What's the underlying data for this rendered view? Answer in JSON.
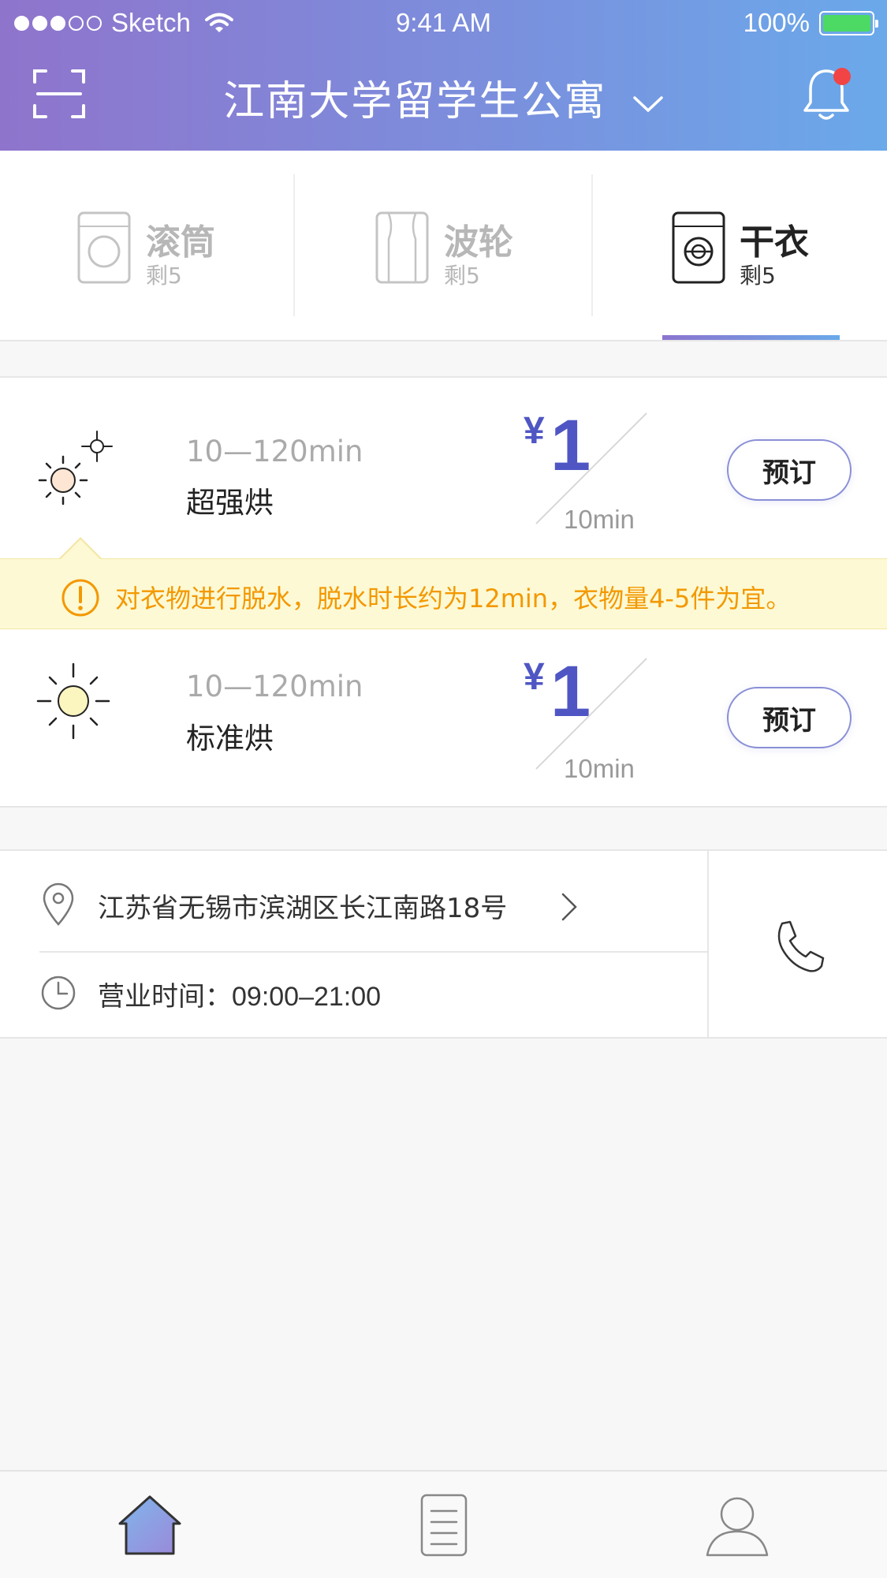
{
  "status_bar": {
    "carrier": "Sketch",
    "time": "9:41 AM",
    "battery": "100%",
    "signal_bars_filled": 3,
    "signal_bars_total": 5
  },
  "header": {
    "title": "江南大学留学生公寓",
    "has_notification": true,
    "icons": [
      "scan-icon",
      "chevron-down-icon",
      "bell-icon"
    ]
  },
  "tabs": [
    {
      "name": "滚筒",
      "count": "剩5",
      "icon": "drum-washer-icon",
      "active": false
    },
    {
      "name": "波轮",
      "count": "剩5",
      "icon": "impeller-washer-icon",
      "active": false
    },
    {
      "name": "干衣",
      "count": "剩5",
      "icon": "dryer-icon",
      "active": true
    }
  ],
  "programs": [
    {
      "time_range": "10—120min",
      "name": "超强烘",
      "currency": "¥",
      "price": "1",
      "unit": "10min",
      "button": "预订",
      "icon": "strong-dry-sun-icon"
    },
    {
      "time_range": "10—120min",
      "name": "标准烘",
      "currency": "¥",
      "price": "1",
      "unit": "10min",
      "button": "预订",
      "icon": "standard-dry-sun-icon"
    }
  ],
  "notice": {
    "text": "对衣物进行脱水，脱水时长约为12min，衣物量4-5件为宜。",
    "icon": "warning-circle-icon"
  },
  "info": {
    "address": "江苏省无锡市滨湖区长江南路18号",
    "hours_label": "营业时间：",
    "hours_value": "09:00–21:00",
    "icons": [
      "location-pin-icon",
      "chevron-right-icon",
      "clock-icon",
      "phone-icon"
    ]
  },
  "tabbar": [
    {
      "icon": "home-icon",
      "active": true
    },
    {
      "icon": "orders-icon",
      "active": false
    },
    {
      "icon": "profile-icon",
      "active": false
    }
  ],
  "colors": {
    "header_gradient_start": "#8f74cc",
    "header_gradient_end": "#6aa9ea",
    "price": "#4f56c4",
    "notice_text": "#f39800",
    "notice_bg": "#fdf9d4",
    "notification_dot": "#f24444",
    "battery": "#4cd964"
  }
}
